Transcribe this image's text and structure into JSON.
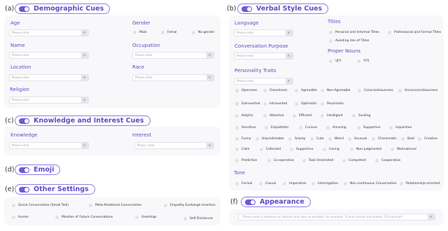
{
  "sections": {
    "a": {
      "letter": "(a)",
      "title": "Demographic Cues"
    },
    "b": {
      "letter": "(b)",
      "title": "Verbal Style Cues"
    },
    "c": {
      "letter": "(c)",
      "title": "Knowledge and Interest Cues"
    },
    "d": {
      "letter": "(d)",
      "title": "Emoji"
    },
    "e": {
      "letter": "(e)",
      "title": "Other Settings"
    },
    "f": {
      "letter": "(f)",
      "title": "Appearance"
    }
  },
  "demographic": {
    "age_label": "Age",
    "name_label": "Name",
    "location_label": "Location",
    "religion_label": "Religion",
    "gender_label": "Gender",
    "occupation_label": "Occupation",
    "race_label": "Race",
    "placeholder": "Please enter",
    "gender_options": [
      "Male",
      "Femal",
      "No gender"
    ]
  },
  "verbal": {
    "language_label": "Language",
    "conversation_purpose_label": "Conversation Purpose",
    "personality_traits_label": "Personality Traits",
    "titles_label": "Titles",
    "proper_nouns_label": "Proper Nouns",
    "tone_label": "Tone",
    "placeholder": "Please enter",
    "titles_options": [
      "Personal and Informal Titles",
      "Professional and Formal Titles",
      "Avoiding Use of Titles"
    ],
    "proper_nouns_options": [
      "내가",
      "우리"
    ],
    "trait_rows": [
      [
        "Openness",
        "Closedness",
        "Agreeable",
        "Non-Agreeable",
        "Conscientiousness",
        "Unconscientiousness"
      ],
      [
        "Extroverted",
        "Introverted",
        "Optimistic",
        "Pessimistic"
      ],
      [
        "Helpful",
        "Attentive",
        "Efficient",
        "Intelligent",
        "Guiding"
      ],
      [
        "Sensitive",
        "Empathetic",
        "Curious",
        "Amusing",
        "Supportive",
        "Inquisitive"
      ],
      [
        "Funny",
        "Unpredictable",
        "Snarky",
        "Cute",
        "Weird",
        "Unusual",
        "Charismatic",
        "Bold",
        "Creative"
      ],
      [
        "Calm",
        "Collected",
        "Supportive",
        "Caring",
        "Non-judgmental",
        "Motivational"
      ],
      [
        "Predictive",
        "Co-operative",
        "Task Orientated",
        "Competent",
        "Cooperative"
      ]
    ],
    "tone_options": [
      "Formal",
      "Casual",
      "Imperative",
      "Interrogative",
      "Non-continuous Conversation",
      "Relationship-oriented"
    ]
  },
  "knowledge": {
    "knowledge_label": "Knowledge",
    "interest_label": "Interest",
    "placeholder": "Please enter"
  },
  "other_settings": {
    "options": [
      "Social Conversation (Small Talk)",
      "Meta-Relational Conversation",
      "Empathy Exchange Insertion",
      "Humor",
      "Mention of Future Conversations",
      "Greetings",
      "Self Disclosure"
    ]
  },
  "appearance": {
    "placeholder": "Please enter a sentence as detailed and clear as possible.  For example, \"A pink-colored marionette, 2D character\""
  },
  "colors": {
    "accent": "#6a5cd6",
    "label": "#5b4fc4",
    "panel": "#f8f8fb"
  }
}
